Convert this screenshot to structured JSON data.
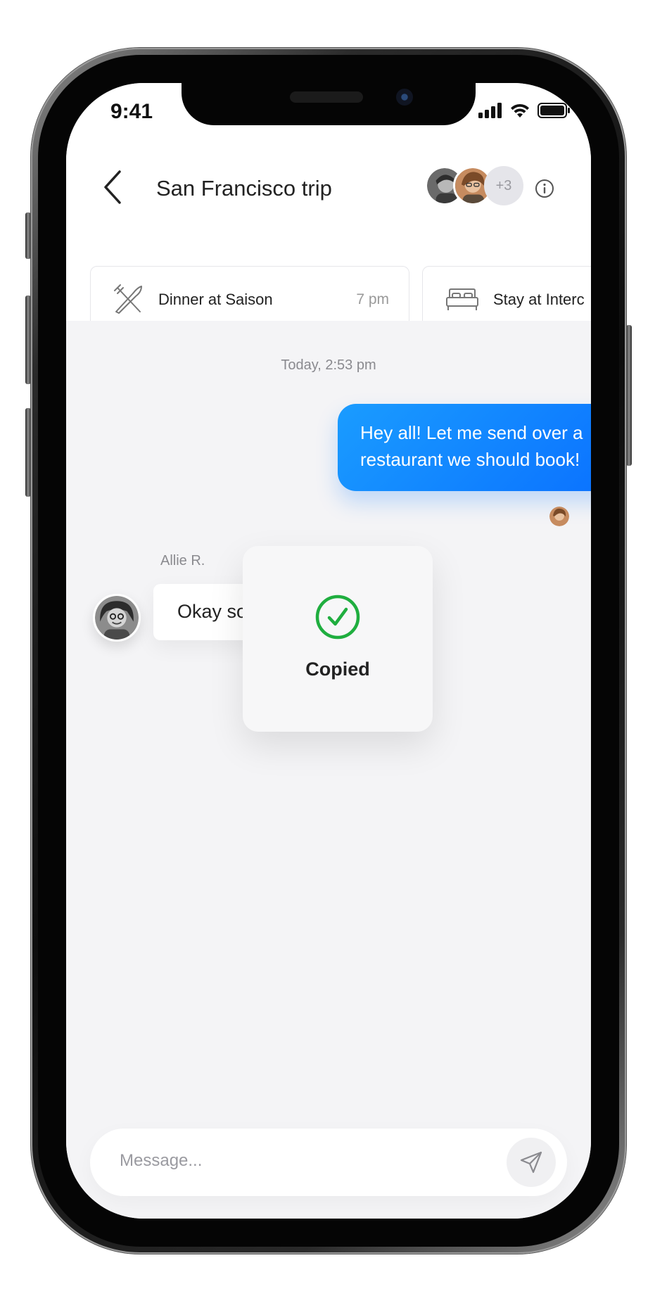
{
  "status_bar": {
    "time": "9:41"
  },
  "header": {
    "title": "San Francisco trip",
    "participants_extra": "+3"
  },
  "plans": [
    {
      "icon": "cutlery-icon",
      "label": "Dinner at Saison",
      "time": "7 pm"
    },
    {
      "icon": "bed-icon",
      "label": "Stay at Interc",
      "time": ""
    }
  ],
  "chat": {
    "timestamp": "Today, 2:53 pm",
    "outgoing": {
      "line1": "Hey all! Let me send over a",
      "line2": "restaurant we should book!"
    },
    "incoming": {
      "sender": "Allie R.",
      "text": "Okay so"
    }
  },
  "toast": {
    "text": "Copied",
    "icon": "checkmark-circle-icon",
    "color": "#1fae3f"
  },
  "composer": {
    "placeholder": "Message..."
  },
  "colors": {
    "accent": "#0a70ff",
    "background": "#f4f4f6"
  }
}
